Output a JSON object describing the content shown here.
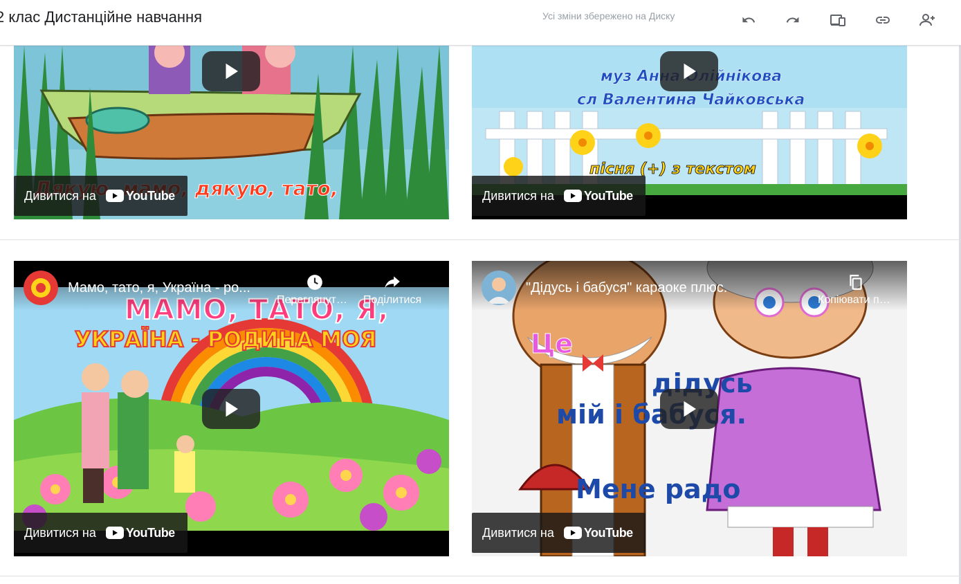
{
  "header": {
    "title": "2 клас Дистанційне навчання",
    "save_status": "Усі зміни збережено на Диску",
    "actions": [
      "undo-icon",
      "redo-icon",
      "preview-icon",
      "link-icon",
      "share-icon"
    ]
  },
  "videos": [
    {
      "watch_label": "Дивитися на",
      "yt_word": "YouTube",
      "overlay_text": "Дякую, мамо, дякую, тато,"
    },
    {
      "watch_label": "Дивитися на",
      "yt_word": "YouTube",
      "overlay_line1": "муз Анна Олійнікова",
      "overlay_line2": "сл Валентина Чайковська",
      "overlay_line3": "пісня (+) з текстом"
    },
    {
      "title": "Мамо, тато, я, Україна - ро...",
      "watch_later": "Переглянути пізніше",
      "share": "Поділитися",
      "watch_label": "Дивитися на",
      "yt_word": "YouTube",
      "overlay_line1": "МАМО, ТАТО, Я,",
      "overlay_line2": "УКРАЇНА - РОДИНА МОЯ"
    },
    {
      "title": "\"Дідусь і бабуся\" караоке плюс.",
      "copy": "Копіювати посилання",
      "watch_label": "Дивитися на",
      "yt_word": "YouTube",
      "overlay_line1": "Це",
      "overlay_line2": "дідусь",
      "overlay_line3": "мій і бабуся.",
      "overlay_line4": "Мене радо"
    }
  ],
  "colors": {
    "accent_red": "#ff0000",
    "overlay_dark": "#171717",
    "divider": "#e0e0e0"
  }
}
